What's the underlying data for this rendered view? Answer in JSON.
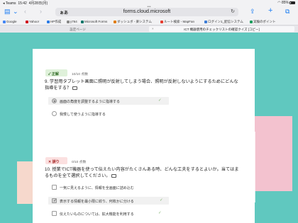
{
  "status": {
    "carrier": "Teams",
    "time": "15:42",
    "date": "4月28日(月)",
    "battery": "85%",
    "dots": "•••"
  },
  "browser": {
    "url": "forms.cloud.microsoft",
    "aa_label": "ぁあ",
    "bookmarks": [
      "Google",
      "Yahoo!",
      "HP作成",
      "y764",
      "Microsoft Forms",
      "ダッシュボ - 楽システム",
      "ルート検索 - MapFan",
      "ログイン1_配信システム",
      "実験のポイント"
    ],
    "tabs": [
      "設定ページ",
      "ICT 機器使用のチェックリストの確認クイズ [コピー]"
    ]
  },
  "quiz": {
    "q9": {
      "result": "正解",
      "score": "10/10 点数",
      "text_line1": "9. 学習用タブレット画面に照明が反射してしまう場合、照明が反射しないようにするためにどんな",
      "text_line2": "指導をする？",
      "options": [
        {
          "label": "画面の角度を調整するように指導する",
          "selected": true,
          "correct": true
        },
        {
          "label": "我慢して使うように指導する",
          "selected": false,
          "correct": false
        }
      ]
    },
    "q10": {
      "result": "誤り",
      "score": "0/10 点数",
      "text_line1": "10. 授業でICT機器を使って伝えたい内容がたくさんある時、どんな工夫をするとよいか。当てはま",
      "text_line2": "るものを全て選択してください。",
      "options": [
        {
          "label": "一気に見えるように、情報を全画面に詰め込む",
          "selected": false,
          "correct": false
        },
        {
          "label": "表示する情報を最小限に絞り、何枚かに分ける",
          "selected": true,
          "correct": true
        },
        {
          "label": "伝えたいものについては、拡大機能を利用する",
          "selected": false,
          "correct": true
        }
      ]
    }
  },
  "colors": {
    "background": "#60c8bf",
    "correct_badge": "#dff1da",
    "wrong_badge": "#fbe0e0",
    "accent": "#1a7cf2"
  }
}
